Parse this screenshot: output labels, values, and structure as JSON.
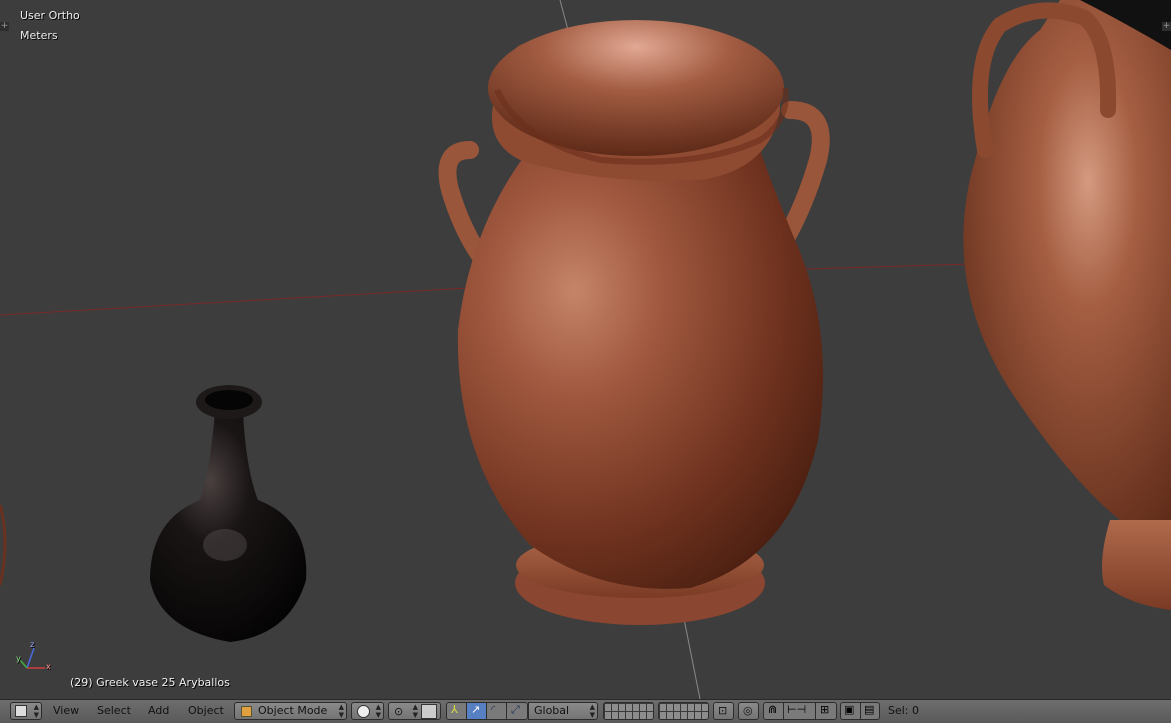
{
  "viewport": {
    "view_name": "User Ortho",
    "units": "Meters",
    "object_info": "(29) Greek vase 25 Aryballos",
    "axis_labels": {
      "x": "x",
      "y": "y",
      "z": "z"
    }
  },
  "header": {
    "menu": {
      "view": "View",
      "select": "Select",
      "add": "Add",
      "object": "Object"
    },
    "mode": "Object Mode",
    "orientation": "Global",
    "sel_count": "Sel: 0"
  },
  "colors": {
    "viewport_bg": "#3d3d3d",
    "terracotta": "#a0583f",
    "black_glaze": "#0d0b0b",
    "active_blue": "#5680c2",
    "x_axis": "#8a2a2a"
  },
  "icons": [
    "editor-type-icon",
    "viewport-shading-icon",
    "pivot-icon",
    "manipulator-icon",
    "translate-icon",
    "rotate-icon",
    "scale-icon",
    "layers-icon",
    "lock-icon",
    "proportional-edit-icon",
    "snap-magnet-icon",
    "snap-element-icon",
    "snap-target-icon",
    "render-icon",
    "render-anim-icon"
  ]
}
